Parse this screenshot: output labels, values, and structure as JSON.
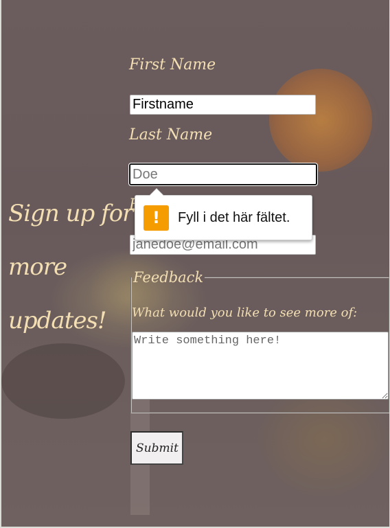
{
  "headline": {
    "line1": "Sign up for",
    "line2": "more",
    "line3": "updates!"
  },
  "form": {
    "first_name": {
      "label": "First Name",
      "value": "Firstname"
    },
    "last_name": {
      "label": "Last Name",
      "placeholder": "Doe"
    },
    "email": {
      "label": "E",
      "placeholder": "janedoe@email.com"
    },
    "feedback": {
      "legend": "Feedback",
      "question": "What would you like to see more of:",
      "placeholder": "Write something here!"
    },
    "submit_label": "Submit"
  },
  "validation": {
    "message": "Fyll i det här fältet.",
    "icon": "warning-icon",
    "icon_glyph": "!",
    "icon_color": "#f59d00"
  },
  "colors": {
    "label_text": "#f3dfb3",
    "overlay": "#6b5c5d"
  }
}
